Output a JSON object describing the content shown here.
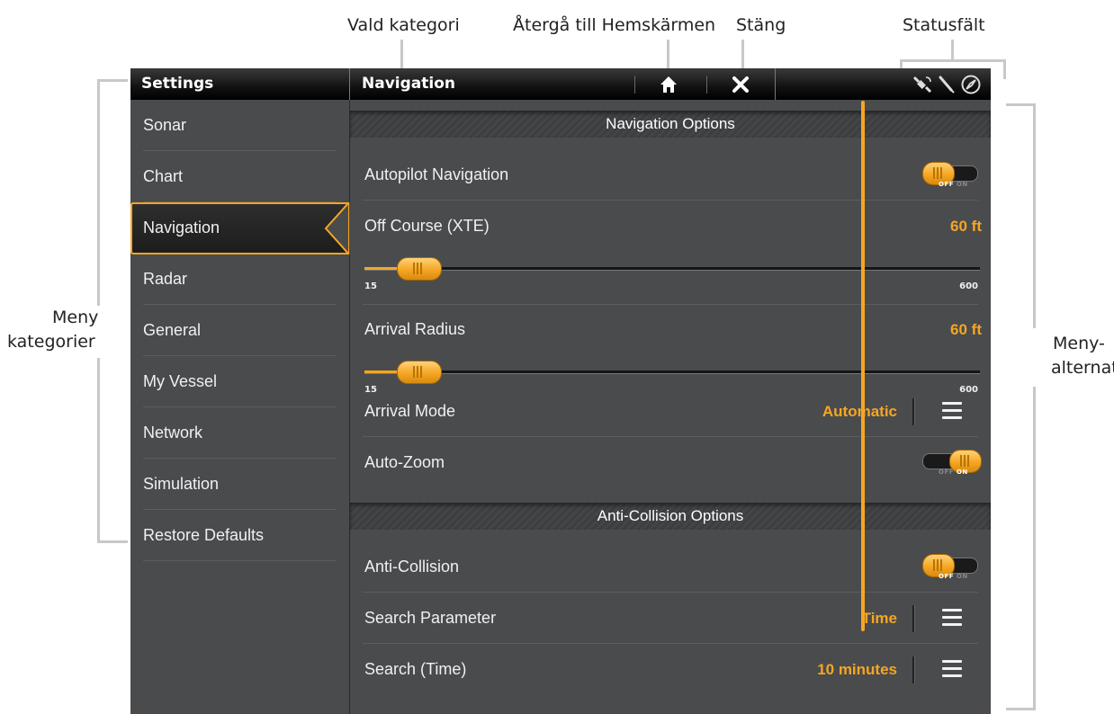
{
  "callouts": {
    "selected_category": "Vald kategori",
    "return_home": "Återgå till Hemskärmen",
    "close": "Stäng",
    "status_bar": "Statusfält",
    "menu_categories_line1": "Meny",
    "menu_categories_line2": "kategorier",
    "menu_options_line1": "Meny-",
    "menu_options_line2": "alternativ"
  },
  "titlebar": {
    "settings_label": "Settings",
    "category_label": "Navigation",
    "home_icon": "home-icon",
    "close_icon": "close-icon",
    "status_icons": [
      "gps-satellite-icon",
      "pen-icon",
      "compass-icon"
    ]
  },
  "sidebar": {
    "items": [
      {
        "label": "Sonar"
      },
      {
        "label": "Chart"
      },
      {
        "label": "Navigation",
        "active": true
      },
      {
        "label": "Radar"
      },
      {
        "label": "General"
      },
      {
        "label": "My Vessel"
      },
      {
        "label": "Network"
      },
      {
        "label": "Simulation"
      },
      {
        "label": "Restore Defaults"
      }
    ]
  },
  "main": {
    "nav_options_header": "Navigation Options",
    "autopilot": {
      "label": "Autopilot Navigation",
      "state": "off",
      "off": "OFF",
      "on": "ON"
    },
    "off_course": {
      "label": "Off Course (XTE)",
      "value": "60 ft",
      "min": "15",
      "max": "600",
      "level": 0.09
    },
    "arrival_radius": {
      "label": "Arrival Radius",
      "value": "60 ft",
      "min": "15",
      "max": "600",
      "level": 0.09
    },
    "arrival_mode": {
      "label": "Arrival Mode",
      "value": "Automatic"
    },
    "auto_zoom": {
      "label": "Auto-Zoom",
      "state": "on",
      "off": "OFF",
      "on": "ON"
    },
    "anti_collision_header": "Anti-Collision Options",
    "anti_collision": {
      "label": "Anti-Collision",
      "state": "off",
      "off": "OFF",
      "on": "ON"
    },
    "search_parameter": {
      "label": "Search Parameter",
      "value": "Time"
    },
    "search_time": {
      "label": "Search (Time)",
      "value": "10 minutes"
    }
  },
  "colors": {
    "accent": "#f5a623",
    "panel": "#4a4b4d",
    "bar": "#000000"
  }
}
